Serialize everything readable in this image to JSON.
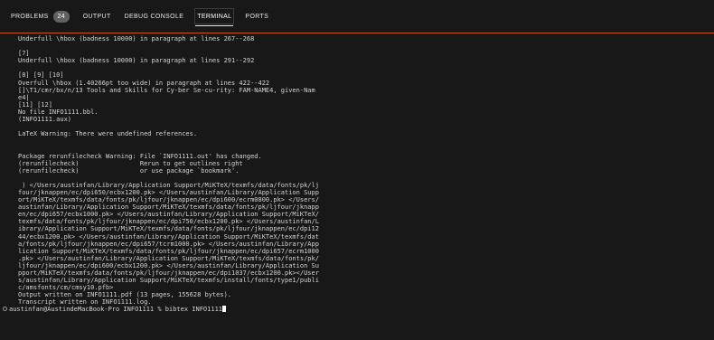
{
  "panel": {
    "tabs": [
      {
        "label": "PROBLEMS",
        "badge": "24"
      },
      {
        "label": "OUTPUT"
      },
      {
        "label": "DEBUG CONSOLE"
      },
      {
        "label": "TERMINAL",
        "active": true
      },
      {
        "label": "PORTS"
      }
    ]
  },
  "terminal": {
    "lines": [
      "Underfull \\hbox (badness 10000) in paragraph at lines 267--268",
      "",
      "[7]",
      "Underfull \\hbox (badness 10000) in paragraph at lines 291--292",
      "",
      "[8] [9] [10]",
      "Overfull \\hbox (1.40266pt too wide) in paragraph at lines 422--422",
      "[]\\T1/cmr/bx/n/13 Tools and Skills for Cy-ber Se-cu-rity: FAM-NAME4, given-Nam",
      "e4|",
      "[11] [12]",
      "No file INFO1111.bbl.",
      "(INFO1111.aux)",
      "",
      "LaTeX Warning: There were undefined references.",
      "",
      "",
      "Package rerunfilecheck Warning: File `INFO1111.out' has changed.",
      "(rerunfilecheck)                Rerun to get outlines right",
      "(rerunfilecheck)                or use package `bookmark'.",
      "",
      " ) </Users/austinfan/Library/Application Support/MiKTeX/texmfs/data/fonts/pk/lj",
      "four/jknappen/ec/dpi650/ecbx1200.pk> </Users/austinfan/Library/Application Supp",
      "ort/MiKTeX/texmfs/data/fonts/pk/ljfour/jknappen/ec/dpi600/ecrm0800.pk> </Users/",
      "austinfan/Library/Application Support/MiKTeX/texmfs/data/fonts/pk/ljfour/jknapp",
      "en/ec/dpi657/ecbx1000.pk> </Users/austinfan/Library/Application Support/MiKTeX/",
      "texmfs/data/fonts/pk/ljfour/jknappen/ec/dpi750/ecbx1200.pk> </Users/austinfan/L",
      "ibrary/Application Support/MiKTeX/texmfs/data/fonts/pk/ljfour/jknappen/ec/dpi12",
      "44/ecbx1200.pk> </Users/austinfan/Library/Application Support/MiKTeX/texmfs/dat",
      "a/fonts/pk/ljfour/jknappen/ec/dpi657/tcrm1000.pk> </Users/austinfan/Library/App",
      "lication Support/MiKTeX/texmfs/data/fonts/pk/ljfour/jknappen/ec/dpi657/ecrm1000",
      ".pk> </Users/austinfan/Library/Application Support/MiKTeX/texmfs/data/fonts/pk/",
      "ljfour/jknappen/ec/dpi600/ecbx1200.pk> </Users/austinfan/Library/Application Su",
      "pport/MiKTeX/texmfs/data/fonts/pk/ljfour/jknappen/ec/dpi1037/ecbx1200.pk></User",
      "s/austinfan/Library/Application Support/MiKTeX/texmfs/install/fonts/type1/publi",
      "c/amsfonts/cm/cmsy10.pfb>",
      "Output written on INFO1111.pdf (13 pages, 155628 bytes).",
      "Transcript written on INFO1111.log."
    ],
    "prompt": "austinfan@AustindeMacBook-Pro INFO1111 % bibtex INFO1111"
  }
}
